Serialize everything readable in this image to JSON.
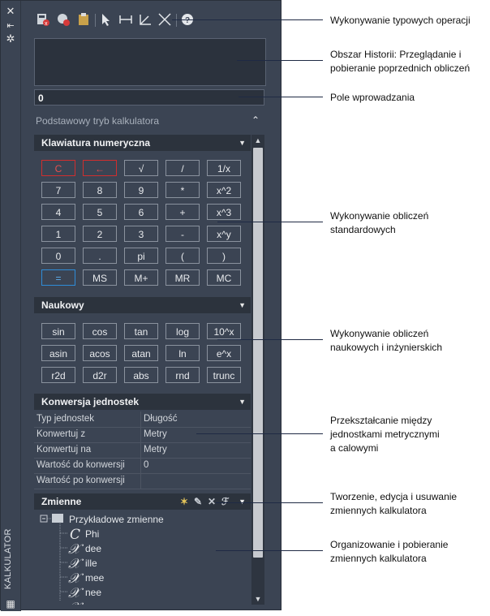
{
  "sidebar": {
    "title": "KALKULATOR"
  },
  "toolbar": {
    "icons": [
      "clear-icon",
      "clear-history-icon",
      "paste-icon",
      "get-coordinates-icon",
      "distance-icon",
      "angle-icon",
      "intersection-icon",
      "help-icon"
    ]
  },
  "input": {
    "value": "0"
  },
  "mode": {
    "label": "Podstawowy tryb kalkulatora"
  },
  "numpad": {
    "title": "Klawiatura numeryczna",
    "rows": [
      [
        "C",
        "←",
        "√",
        "/",
        "1/x"
      ],
      [
        "7",
        "8",
        "9",
        "*",
        "x^2"
      ],
      [
        "4",
        "5",
        "6",
        "+",
        "x^3"
      ],
      [
        "1",
        "2",
        "3",
        "-",
        "x^y"
      ],
      [
        "0",
        ".",
        "pi",
        "(",
        ")"
      ],
      [
        "=",
        "MS",
        "M+",
        "MR",
        "MC"
      ]
    ]
  },
  "scientific": {
    "title": "Naukowy",
    "rows": [
      [
        "sin",
        "cos",
        "tan",
        "log",
        "10^x"
      ],
      [
        "asin",
        "acos",
        "atan",
        "ln",
        "e^x"
      ],
      [
        "r2d",
        "d2r",
        "abs",
        "rnd",
        "trunc"
      ]
    ]
  },
  "units": {
    "title": "Konwersja jednostek",
    "rows": [
      {
        "k": "Typ jednostek",
        "v": "Długość"
      },
      {
        "k": "Konwertuj z",
        "v": "Metry"
      },
      {
        "k": "Konwertuj na",
        "v": "Metry"
      },
      {
        "k": "Wartość do konwersji",
        "v": "0"
      },
      {
        "k": "Wartość po konwersji",
        "v": ""
      }
    ]
  },
  "variables": {
    "title": "Zmienne",
    "tree_root": "Przykładowe zmienne",
    "items": [
      "Phi",
      "dee",
      "ille",
      "mee",
      "nee"
    ]
  },
  "annotations": [
    {
      "lines": [
        "Wykonywanie typowych operacji"
      ]
    },
    {
      "lines": [
        "Obszar Historii: Przeglądanie i",
        "pobieranie poprzednich obliczeń"
      ]
    },
    {
      "lines": [
        "Pole wprowadzania"
      ]
    },
    {
      "lines": [
        "Wykonywanie obliczeń",
        "standardowych"
      ]
    },
    {
      "lines": [
        "Wykonywanie obliczeń",
        "naukowych i inżynierskich"
      ]
    },
    {
      "lines": [
        "Przekształcanie między",
        "jednostkami metrycznymi",
        "a calowymi"
      ]
    },
    {
      "lines": [
        "Tworzenie, edycja i usuwanie",
        "zmiennych kalkulatora"
      ]
    },
    {
      "lines": [
        "Organizowanie i pobieranie",
        "zmiennych kalkulatora"
      ]
    }
  ]
}
